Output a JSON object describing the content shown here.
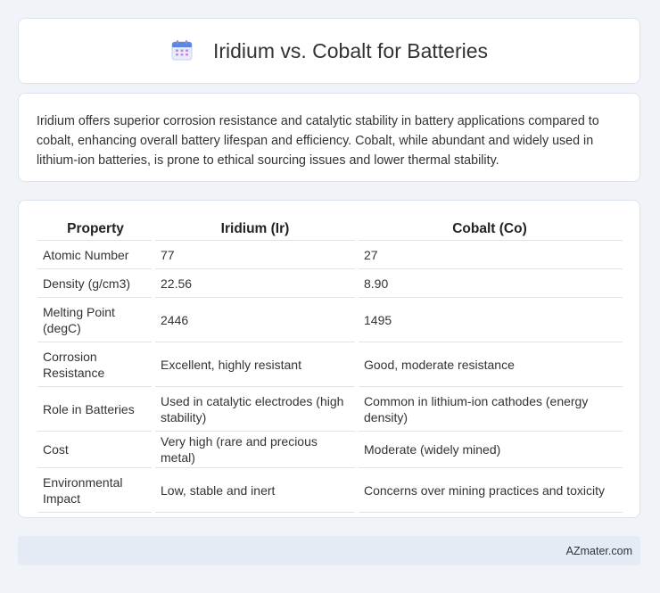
{
  "header": {
    "title": "Iridium vs. Cobalt for Batteries",
    "icon": "calendar-icon"
  },
  "summary": {
    "text": "Iridium offers superior corrosion resistance and catalytic stability in battery applications compared to cobalt, enhancing overall battery lifespan and efficiency. Cobalt, while abundant and widely used in lithium-ion batteries, is prone to ethical sourcing issues and lower thermal stability."
  },
  "table": {
    "headers": [
      "Property",
      "Iridium (Ir)",
      "Cobalt (Co)"
    ],
    "rows": [
      [
        "Atomic Number",
        "77",
        "27"
      ],
      [
        "Density (g/cm3)",
        "22.56",
        "8.90"
      ],
      [
        "Melting Point (degC)",
        "2446",
        "1495"
      ],
      [
        "Corrosion Resistance",
        "Excellent, highly resistant",
        "Good, moderate resistance"
      ],
      [
        "Role in Batteries",
        "Used in catalytic electrodes (high stability)",
        "Common in lithium-ion cathodes (energy density)"
      ],
      [
        "Cost",
        "Very high (rare and precious metal)",
        "Moderate (widely mined)"
      ],
      [
        "Environmental Impact",
        "Low, stable and inert",
        "Concerns over mining practices and toxicity"
      ]
    ]
  },
  "footer": {
    "text": "AZmater.com"
  }
}
